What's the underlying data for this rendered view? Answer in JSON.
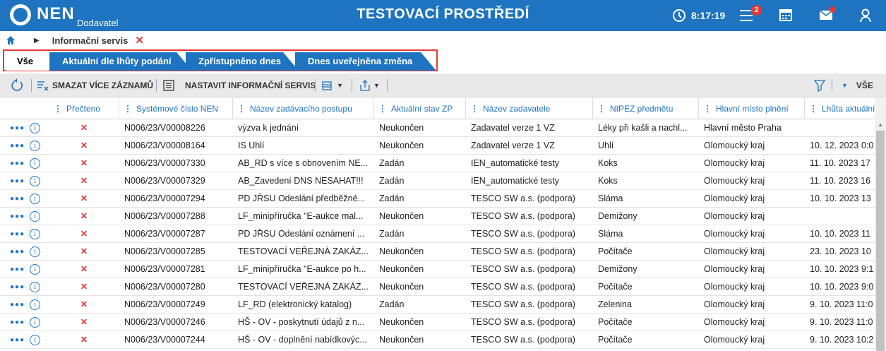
{
  "header": {
    "logo_text": "NEN",
    "logo_sub": "Dodavatel",
    "env_title": "TESTOVACÍ PROSTŘEDÍ",
    "time": "8:17:19",
    "menu_badge": "2"
  },
  "breadcrumb": {
    "label": "Informační servis"
  },
  "tabs": [
    "Vše",
    "Aktuální dle lhůty podání",
    "Zpřístupněno dnes",
    "Dnes uveřejněna změna"
  ],
  "toolbar": {
    "delete_label": "SMAZAT VÍCE ZÁZNAMŮ",
    "settings_label": "NASTAVIT INFORMAČNÍ SERVIS",
    "filter_label": "VŠE"
  },
  "columns": [
    "Přečteno",
    "Systémové číslo NEN",
    "Název zadávacího postupu",
    "Aktuální stav ZP",
    "Název zadavatele",
    "NIPEZ předmětu",
    "Hlavní místo plnění",
    "Lhůta aktuální"
  ],
  "rows": [
    {
      "id": "N006/23/V00008226",
      "name": "výzva k jednání",
      "state": "Neukončen",
      "buyer": "Zadavatel verze 1 VZ",
      "nipez": "Léky při kašli a nachl...",
      "place": "Hlavní město Praha",
      "deadline": ""
    },
    {
      "id": "N006/23/V00008164",
      "name": "IS Uhlí",
      "state": "Neukončen",
      "buyer": "Zadavatel verze 1 VZ",
      "nipez": "Uhlí",
      "place": "Olomoucký kraj",
      "deadline": "10. 12. 2023 0:0"
    },
    {
      "id": "N006/23/V00007330",
      "name": "AB_RD s více s obnovením NE...",
      "state": "Zadán",
      "buyer": "IEN_automatické testy",
      "nipez": "Koks",
      "place": "Olomoucký kraj",
      "deadline": "11. 10. 2023 17"
    },
    {
      "id": "N006/23/V00007329",
      "name": "AB_Zavedení DNS NESAHAT!!!",
      "state": "Zadán",
      "buyer": "IEN_automatické testy",
      "nipez": "Koks",
      "place": "Olomoucký kraj",
      "deadline": "11. 10. 2023 16"
    },
    {
      "id": "N006/23/V00007294",
      "name": "PD JŘSU Odeslání předběžné...",
      "state": "Zadán",
      "buyer": "TESCO SW a.s. (podpora)",
      "nipez": "Sláma",
      "place": "Olomoucký kraj",
      "deadline": "10. 10. 2023 13"
    },
    {
      "id": "N006/23/V00007288",
      "name": "LF_minipříručka \"E-aukce mal...",
      "state": "Neukončen",
      "buyer": "TESCO SW a.s. (podpora)",
      "nipez": "Demižony",
      "place": "Olomoucký kraj",
      "deadline": ""
    },
    {
      "id": "N006/23/V00007287",
      "name": "PD JŘSU Odeslání oznámení ...",
      "state": "Zadán",
      "buyer": "TESCO SW a.s. (podpora)",
      "nipez": "Sláma",
      "place": "Olomoucký kraj",
      "deadline": "10. 10. 2023 11"
    },
    {
      "id": "N006/23/V00007285",
      "name": "TESTOVACÍ VEŘEJNÁ ZAKÁZ...",
      "state": "Neukončen",
      "buyer": "TESCO SW a.s. (podpora)",
      "nipez": "Počítače",
      "place": "Olomoucký kraj",
      "deadline": "23. 10. 2023 10"
    },
    {
      "id": "N006/23/V00007281",
      "name": "LF_minipříručka \"E-aukce po h...",
      "state": "Neukončen",
      "buyer": "TESCO SW a.s. (podpora)",
      "nipez": "Demižony",
      "place": "Olomoucký kraj",
      "deadline": "10. 10. 2023 9:1"
    },
    {
      "id": "N006/23/V00007280",
      "name": "TESTOVACÍ VEŘEJNÁ ZAKÁZ...",
      "state": "Neukončen",
      "buyer": "TESCO SW a.s. (podpora)",
      "nipez": "Počítače",
      "place": "Olomoucký kraj",
      "deadline": "10. 10. 2023 9:0"
    },
    {
      "id": "N006/23/V00007249",
      "name": "LF_RD (elektronický katalog)",
      "state": "Zadán",
      "buyer": "TESCO SW a.s. (podpora)",
      "nipez": "Zelenina",
      "place": "Olomoucký kraj",
      "deadline": "9. 10. 2023 11:0"
    },
    {
      "id": "N006/23/V00007246",
      "name": "HŠ - OV - poskytnutí údajů z n...",
      "state": "Neukončen",
      "buyer": "TESCO SW a.s. (podpora)",
      "nipez": "Počítače",
      "place": "Olomoucký kraj",
      "deadline": "9. 10. 2023 11:0"
    },
    {
      "id": "N006/23/V00007244",
      "name": "HŠ - OV - doplnění nabídkovýc...",
      "state": "Neukončen",
      "buyer": "TESCO SW a.s. (podpora)",
      "nipez": "Počítače",
      "place": "Olomoucký kraj",
      "deadline": "9. 10. 2023 10:2"
    }
  ],
  "read_mark": "✕",
  "colors": {
    "brand": "#1e74c0",
    "alert": "#e53935"
  }
}
